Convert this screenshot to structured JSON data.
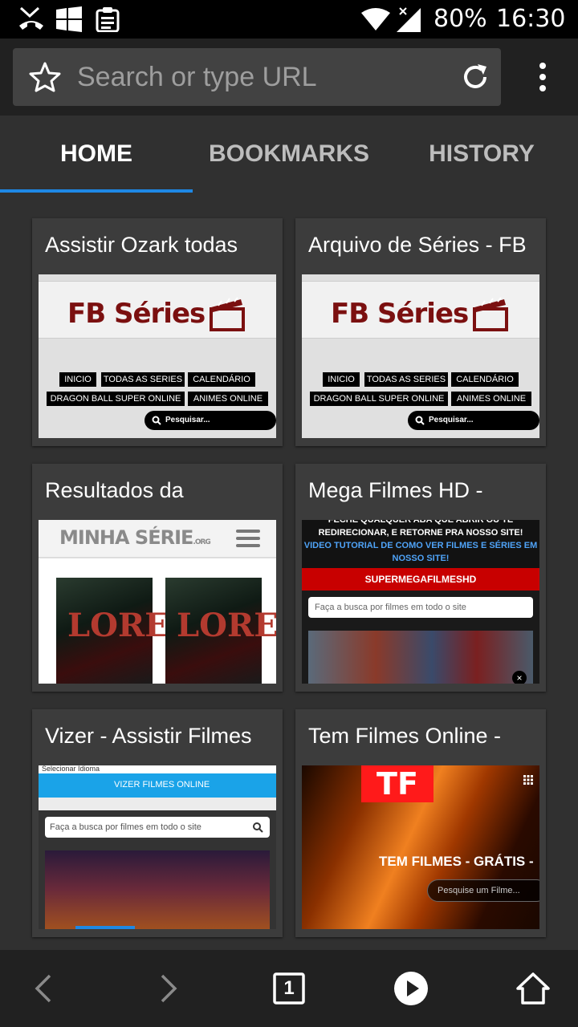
{
  "status_bar": {
    "battery": "80%",
    "time": "16:30"
  },
  "toolbar": {
    "search_placeholder": "Search or type URL"
  },
  "tabs": [
    {
      "label": "HOME"
    },
    {
      "label": "BOOKMARKS"
    },
    {
      "label": "HISTORY"
    }
  ],
  "tiles": [
    {
      "title": "Assistir Ozark todas",
      "logo": "FB Séries",
      "menu": [
        "INICIO",
        "TODAS AS SERIES",
        "CALENDÁRIO",
        "DRAGON BALL SUPER ONLINE",
        "ANIMES ONLINE"
      ],
      "search": "Pesquisar..."
    },
    {
      "title": "Arquivo de Séries - FB",
      "logo": "FB Séries",
      "menu": [
        "INICIO",
        "TODAS AS SERIES",
        "CALENDÁRIO",
        "DRAGON BALL SUPER ONLINE",
        "ANIMES ONLINE"
      ],
      "search": "Pesquisar..."
    },
    {
      "title": "Resultados da",
      "logo": "MINHA SÉRIE",
      "logo_suffix": ".ORG",
      "poster_text": "LORE"
    },
    {
      "title": "Mega Filmes HD -",
      "notice_line1": "FECHE QUALQUER ABA QUE ABRIR OU TE",
      "notice_line2": "REDIRECIONAR, E RETORNE PRA NOSSO SITE!",
      "notice_blue": "VIDEO TUTORIAL DE COMO VER FILMES E SÉRIES EM NOSSO SITE!",
      "brand": "SUPERMEGAFILMESHD",
      "search_placeholder": "Faça a busca por filmes em todo o site"
    },
    {
      "title": "Vizer - Assistir Filmes",
      "lang": "Selecionar Idioma",
      "logo": "VIZER FILMES ONLINE",
      "search_placeholder": "Faça a busca por filmes em todo o site"
    },
    {
      "title": "Tem Filmes Online -",
      "logo": "TF",
      "tagline": "TEM FILMES - GRÁTIS -",
      "search_placeholder": "Pesquise um Filme..."
    }
  ],
  "bottom_nav": {
    "tab_count": "1"
  },
  "colors": {
    "accent": "#1e88e5",
    "background": "#303030",
    "toolbar": "#212121",
    "fb_logo": "#7b1010"
  }
}
